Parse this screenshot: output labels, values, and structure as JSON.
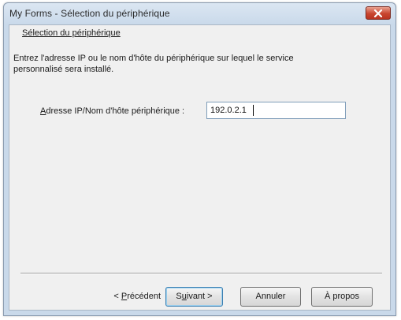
{
  "window": {
    "title": "My Forms - Sélection du périphérique"
  },
  "page": {
    "heading": "Sélection du périphérique",
    "description": "Entrez l'adresse IP ou le nom d'hôte du périphérique sur lequel le service personnalisé sera installé."
  },
  "form": {
    "label_accel": "A",
    "label_rest": "dresse IP/Nom d'hôte périphérique :",
    "ip_value": "192.0.2.1"
  },
  "buttons": {
    "prev_before": "< ",
    "prev_accel": "P",
    "prev_rest": "récédent",
    "next_before": "S",
    "next_accel": "u",
    "next_rest": "ivant >",
    "cancel": "Annuler",
    "about": "À propos"
  },
  "icons": {
    "close": "close-icon"
  }
}
